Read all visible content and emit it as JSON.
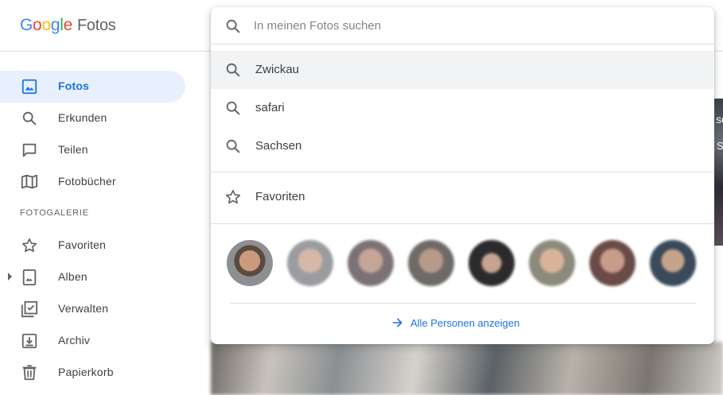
{
  "app": {
    "logo_google": [
      "G",
      "o",
      "o",
      "g",
      "l",
      "e"
    ],
    "logo_google_colors": [
      "#4285f4",
      "#ea4335",
      "#fbbc05",
      "#4285f4",
      "#34a853",
      "#ea4335"
    ],
    "logo_product": "Fotos"
  },
  "search": {
    "placeholder": "In meinen Fotos suchen",
    "value": "",
    "suggestions": [
      "Zwickau",
      "safari",
      "Sachsen"
    ],
    "favorites_label": "Favoriten",
    "all_people_label": "Alle Personen anzeigen",
    "people_count": 8
  },
  "sidebar": {
    "items": [
      {
        "label": "Fotos",
        "icon": "photo-icon",
        "active": true
      },
      {
        "label": "Erkunden",
        "icon": "search-icon"
      },
      {
        "label": "Teilen",
        "icon": "chat-icon"
      },
      {
        "label": "Fotobücher",
        "icon": "book-icon"
      }
    ],
    "section_label": "FOTOGALERIE",
    "library": [
      {
        "label": "Favoriten",
        "icon": "star-icon"
      },
      {
        "label": "Alben",
        "icon": "album-icon"
      },
      {
        "label": "Verwalten",
        "icon": "utilities-icon"
      },
      {
        "label": "Archiv",
        "icon": "archive-icon"
      },
      {
        "label": "Papierkorb",
        "icon": "trash-icon"
      }
    ]
  },
  "background_photo": {
    "strip_text_1": "sc",
    "strip_text_2": "S"
  },
  "colors": {
    "accent": "#1a73e8",
    "active_bg": "#e8f0fe",
    "highlight_row": "#f1f3f4",
    "icon_gray": "#5f6368"
  }
}
